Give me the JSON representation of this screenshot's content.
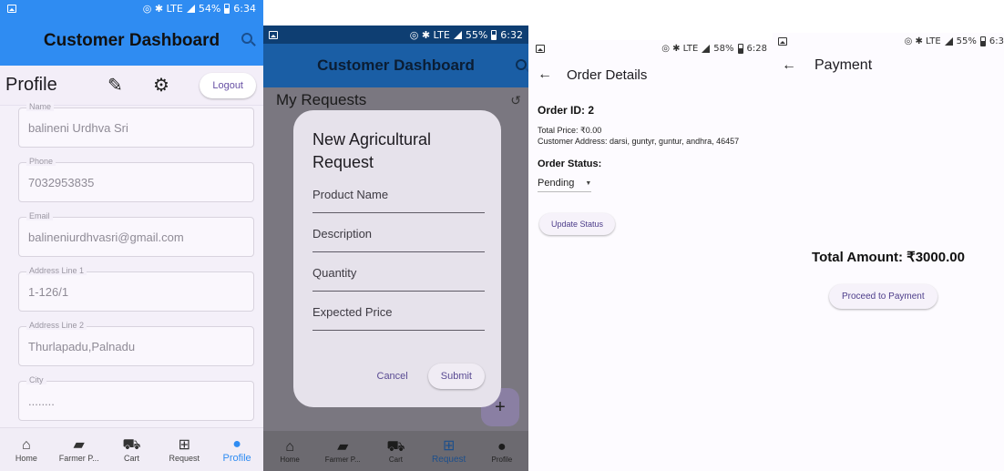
{
  "profile_screen": {
    "status": {
      "icons": "◎ ✱ LTE",
      "battery": "54%",
      "time": "6:34"
    },
    "app_title": "Customer Dashboard",
    "header": {
      "title": "Profile",
      "logout_label": "Logout"
    },
    "fields": [
      {
        "label": "Name",
        "value": "balineni Urdhva Sri"
      },
      {
        "label": "Phone",
        "value": "7032953835"
      },
      {
        "label": "Email",
        "value": "balineniurdhvasri@gmail.com"
      },
      {
        "label": "Address Line 1",
        "value": "1-126/1"
      },
      {
        "label": "Address Line 2",
        "value": "Thurlapadu,Palnadu"
      },
      {
        "label": "City",
        "value": "........"
      }
    ],
    "nav": [
      {
        "label": "Home",
        "icon": "home-icon"
      },
      {
        "label": "Farmer P...",
        "icon": "bag-icon"
      },
      {
        "label": "Cart",
        "icon": "cart-icon"
      },
      {
        "label": "Request",
        "icon": "add-box-icon"
      },
      {
        "label": "Profile",
        "icon": "person-icon",
        "active": true
      }
    ]
  },
  "request_screen": {
    "status": {
      "icons": "◎ ✱ LTE",
      "battery": "55%",
      "time": "6:32"
    },
    "app_title": "Customer Dashboard",
    "section_title": "My Requests",
    "dialog": {
      "title": "New Agricultural Request",
      "fields": [
        "Product Name",
        "Description",
        "Quantity",
        "Expected Price"
      ],
      "cancel_label": "Cancel",
      "submit_label": "Submit"
    },
    "fab_label": "+",
    "nav": [
      {
        "label": "Home"
      },
      {
        "label": "Farmer P..."
      },
      {
        "label": "Cart"
      },
      {
        "label": "Request",
        "active": true
      },
      {
        "label": "Profile"
      }
    ]
  },
  "order_screen": {
    "status": {
      "icons": "◎ ✱ LTE",
      "battery": "58%",
      "time": "6:28"
    },
    "title": "Order Details",
    "order_id": "Order ID: 2",
    "total_price": "Total Price: ₹0.00",
    "address": "Customer Address: darsi, guntyr, guntur, andhra, 46457",
    "status_heading": "Order Status:",
    "status_value": "Pending",
    "update_label": "Update Status"
  },
  "payment_screen": {
    "status": {
      "icons": "◎ ✱ LTE",
      "battery": "55%",
      "time": "6:3"
    },
    "title": "Payment",
    "total_amount": "Total Amount: ₹3000.00",
    "pay_label": "Proceed to Payment"
  },
  "colors": {
    "primary": "#2f8cf2",
    "accent": "#6750a4",
    "surface": "#f4f0f9"
  }
}
